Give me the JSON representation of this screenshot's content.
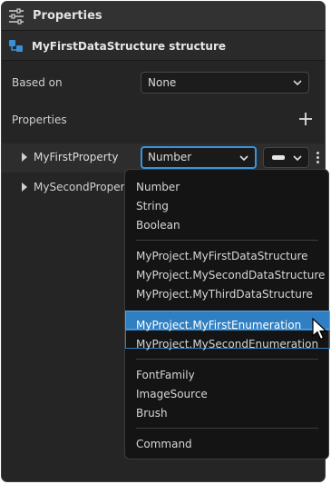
{
  "panel": {
    "title": "Properties",
    "icon": "sliders-icon"
  },
  "structure": {
    "label": "MyFirstDataStructure structure",
    "icon": "structure-icon"
  },
  "based_on": {
    "label": "Based on",
    "value": "None"
  },
  "properties_section": {
    "label": "Properties"
  },
  "properties": [
    {
      "name": "MyFirstProperty",
      "type": "Number"
    },
    {
      "name": "MySecondPropert"
    }
  ],
  "type_menu": {
    "groups": [
      [
        "Number",
        "String",
        "Boolean"
      ],
      [
        "MyProject.MyFirstDataStructure",
        "MyProject.MySecondDataStructure",
        "MyProject.MyThirdDataStructure"
      ],
      [
        "MyProject.MyFirstEnumeration",
        "MyProject.MySecondEnumeration"
      ],
      [
        "FontFamily",
        "ImageSource",
        "Brush"
      ],
      [
        "Command"
      ]
    ],
    "highlighted": "MyProject.MyFirstEnumeration"
  },
  "colors": {
    "accent": "#2f7fc2",
    "panel_bg": "#252525",
    "menu_bg": "#141414"
  }
}
